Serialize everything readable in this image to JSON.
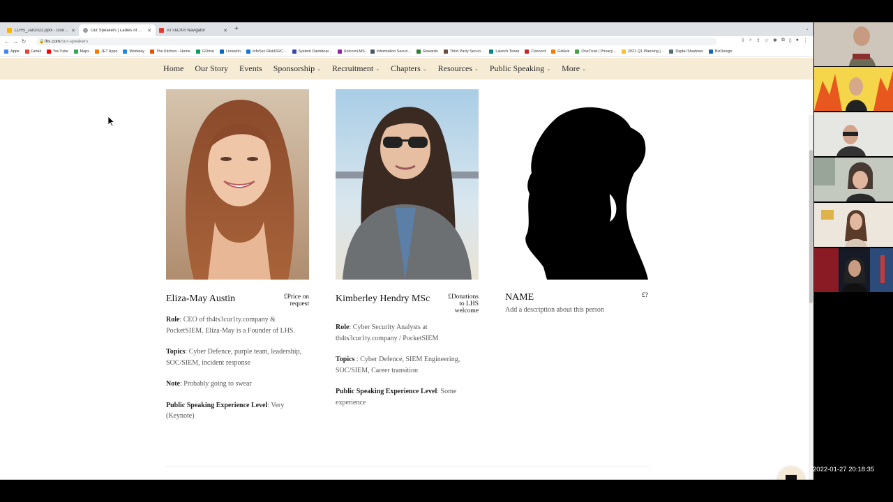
{
  "browser": {
    "tabs": [
      {
        "label": "LLHS_Jan2022.pptx - Google Slides",
        "color": "#f4b400",
        "active": false
      },
      {
        "label": "Our Speakers | Ladies of London Hacking Society",
        "color": "#9aa0a6",
        "active": true
      },
      {
        "label": "ATT&CK® Navigator",
        "color": "#e53935",
        "active": false
      }
    ],
    "url_host": "lhs.com",
    "url_path": "/our-speakers",
    "bookmarks": [
      {
        "label": "Apps",
        "color": "#4285f4"
      },
      {
        "label": "Gmail",
        "color": "#ea4335"
      },
      {
        "label": "YouTube",
        "color": "#ff0000"
      },
      {
        "label": "Maps",
        "color": "#34a853"
      },
      {
        "label": "JET Apps",
        "color": "#f57c00"
      },
      {
        "label": "Workday",
        "color": "#1e88e5"
      },
      {
        "label": "The Kitchen - Home",
        "color": "#e65100"
      },
      {
        "label": "GDrive",
        "color": "#0f9d58"
      },
      {
        "label": "LinkedIn",
        "color": "#0a66c2"
      },
      {
        "label": "InfoSec RiskISRC...",
        "color": "#1976d2"
      },
      {
        "label": "System Dashboar...",
        "color": "#3949ab"
      },
      {
        "label": "UnicornLMS",
        "color": "#8e24aa"
      },
      {
        "label": "Information Securi...",
        "color": "#455a64"
      },
      {
        "label": "Rewards",
        "color": "#2e7d32"
      },
      {
        "label": "Third Party Securi...",
        "color": "#6d4c41"
      },
      {
        "label": "Launch Tower",
        "color": "#00897b"
      },
      {
        "label": "Concord",
        "color": "#c62828"
      },
      {
        "label": "GitHub",
        "color": "#f57c00"
      },
      {
        "label": "OneTrust | Privacy...",
        "color": "#43a047"
      },
      {
        "label": "2021 Q1 Planning |...",
        "color": "#fbc02d"
      },
      {
        "label": "Digital Shadows",
        "color": "#546e7a"
      },
      {
        "label": "BizDesign",
        "color": "#1565c0"
      }
    ]
  },
  "site_nav": [
    {
      "label": "Home",
      "dropdown": false
    },
    {
      "label": "Our Story",
      "dropdown": false
    },
    {
      "label": "Events",
      "dropdown": false
    },
    {
      "label": "Sponsorship",
      "dropdown": true
    },
    {
      "label": "Recruitment",
      "dropdown": true
    },
    {
      "label": "Chapters",
      "dropdown": true
    },
    {
      "label": "Resources",
      "dropdown": true
    },
    {
      "label": "Public Speaking",
      "dropdown": true
    },
    {
      "label": "More",
      "dropdown": true
    }
  ],
  "speakers": [
    {
      "name": "Eliza-May Austin",
      "price_line1": "£Price on",
      "price_line2": "request",
      "price_line3": "",
      "role_label": "Role",
      "role": ": CEO of th4ts3cur1ty.company & PocketSIEM. Eliza-May is a Founder of LHS.",
      "topics_label": "Topics",
      "topics": ": Cyber Defence, purple team, leadership, SOC/SIEM, incident response",
      "note_label": "Note",
      "note": ": Probably going to swear",
      "level_label": "Public Speaking Experience Level",
      "level": ": Very (Keynote)"
    },
    {
      "name": "Kimberley Hendry MSc",
      "price_line1": "£Donations",
      "price_line2": "to LHS",
      "price_line3": "welcome",
      "role_label": "Role",
      "role": ": Cyber Security Analysts at th4ts3cur1ty.company / PocketSIEM",
      "topics_label": "Topics",
      "topics": " : Cyber Defence, SIEM Engineering, SOC/SIEM, Career transition",
      "level_label": "Public Speaking Experience Level",
      "level": ":  Some experience"
    },
    {
      "name": "NAME",
      "price_line1": "£?",
      "description": "Add a description about this person"
    }
  ],
  "timestamp": "2022-01-27 20:18:35",
  "colors": {
    "nav_bg": "#f6ecd6",
    "page_bg": "#ffffff",
    "screen_bg": "#000000"
  }
}
